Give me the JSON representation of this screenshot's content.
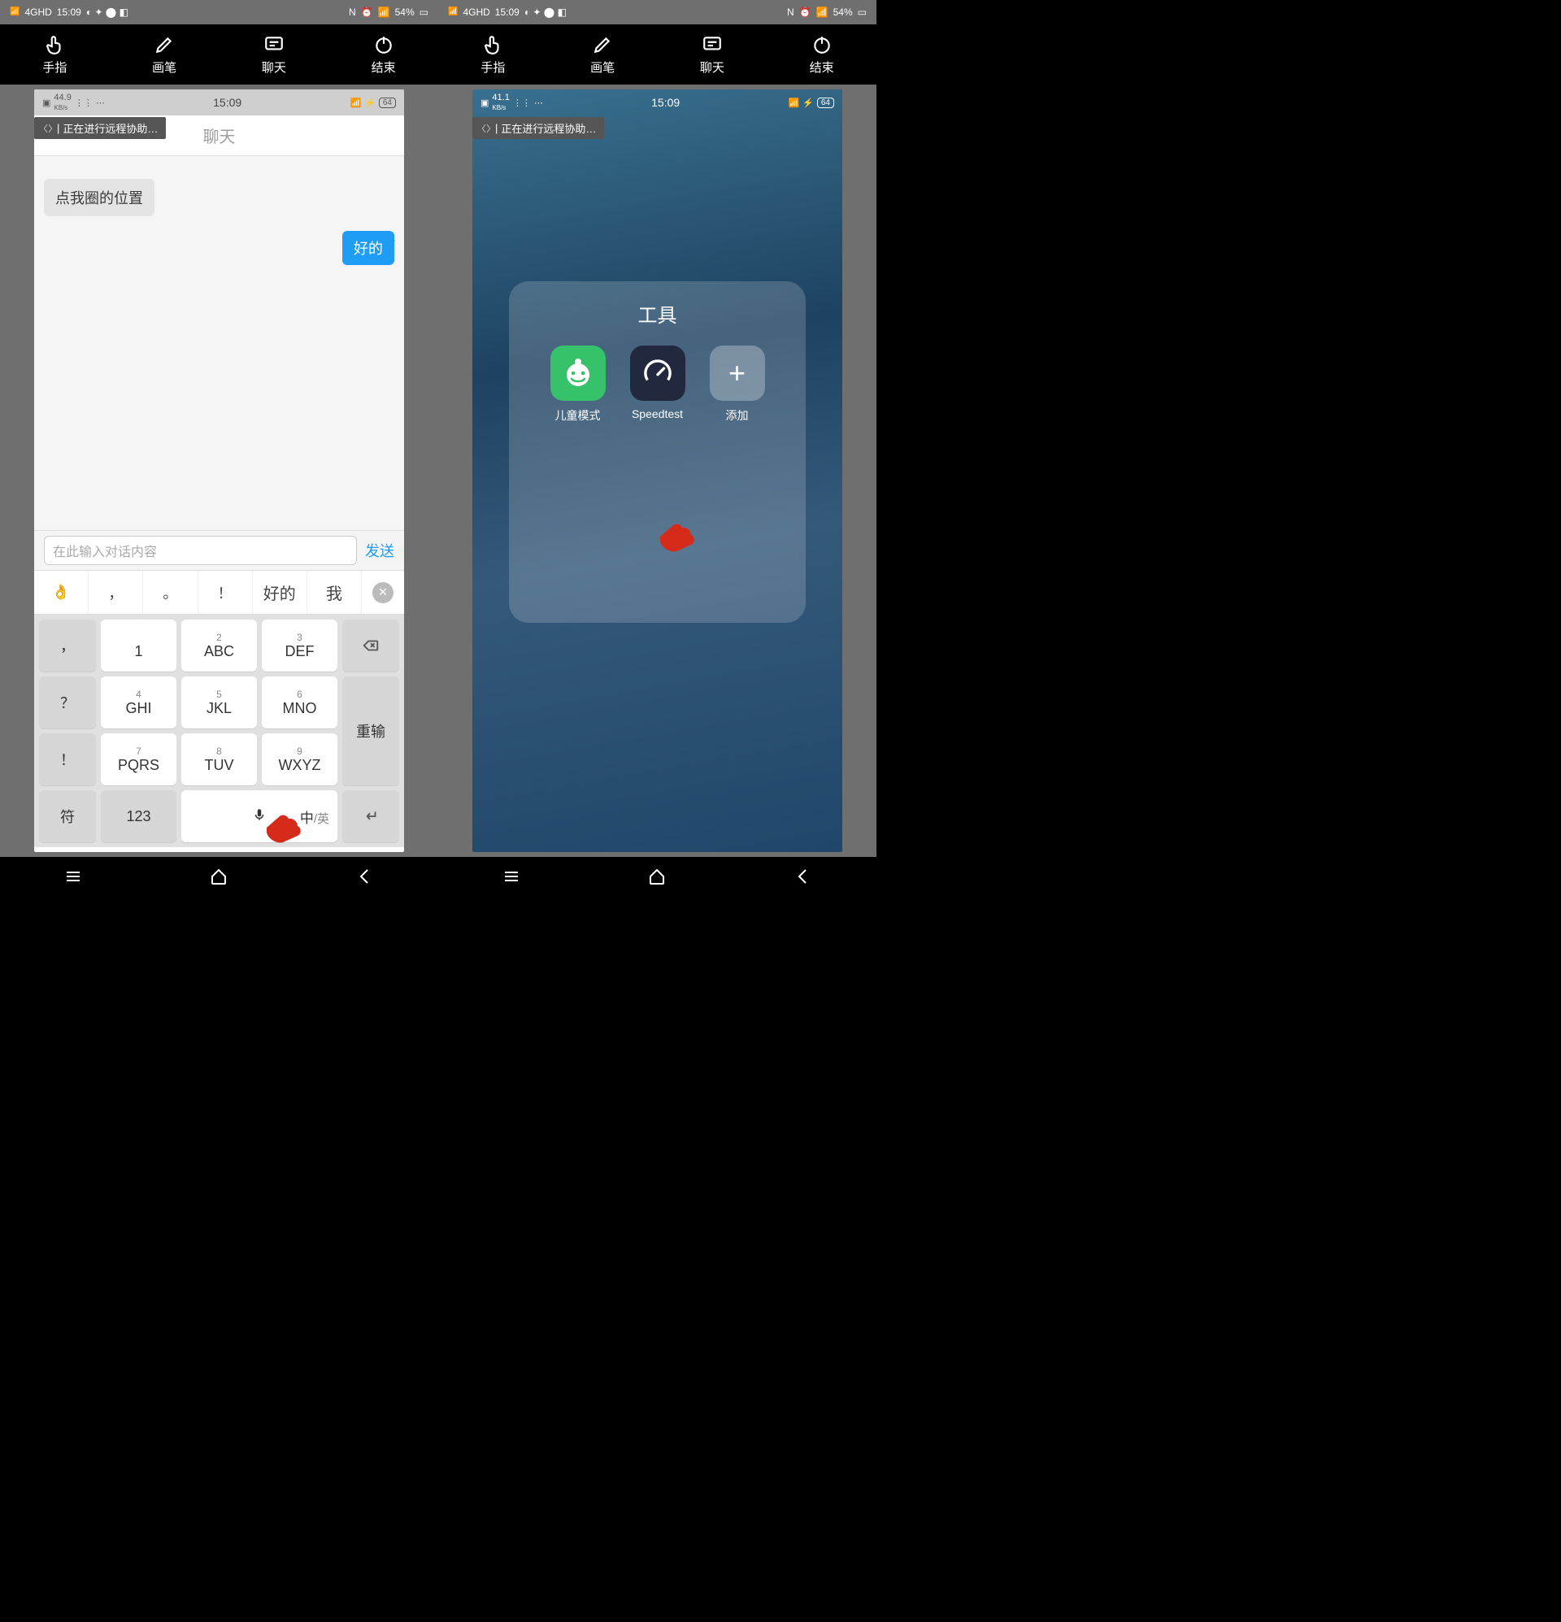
{
  "outerStatus": {
    "netLabel": "4GHD",
    "time": "15:09",
    "battery": "54%"
  },
  "toolbar": {
    "finger": "手指",
    "brush": "画笔",
    "chat": "聊天",
    "end": "结束"
  },
  "remoteBanner": "正在进行远程协助…",
  "leftPhone": {
    "status": {
      "speed": "44.9",
      "speedUnit": "KB/s",
      "time": "15:09",
      "batt": "64"
    },
    "chatTitle": "聊天",
    "msgIn": "点我圈的位置",
    "msgOut": "好的",
    "inputPlaceholder": "在此输入对话内容",
    "sendLabel": "发送",
    "suggestions": [
      "👌",
      "，",
      "。",
      "！",
      "好的",
      "我"
    ],
    "keys": {
      "r1": [
        {
          "sym": "，"
        },
        {
          "n": "1"
        },
        {
          "n": "2",
          "l": "ABC"
        },
        {
          "n": "3",
          "l": "DEF"
        },
        {
          "sym": "bksp"
        }
      ],
      "r2": [
        {
          "sym": "？"
        },
        {
          "n": "4",
          "l": "GHI"
        },
        {
          "n": "5",
          "l": "JKL"
        },
        {
          "n": "6",
          "l": "MNO"
        },
        {
          "sym": "重输"
        }
      ],
      "r3": [
        {
          "sym": "！"
        },
        {
          "n": "7",
          "l": "PQRS"
        },
        {
          "n": "8",
          "l": "TUV"
        },
        {
          "n": "9",
          "l": "WXYZ"
        }
      ],
      "r4": {
        "fn": "符",
        "num": "123",
        "langZh": "中",
        "langEn": "英"
      }
    }
  },
  "rightPhone": {
    "status": {
      "speed": "41.1",
      "speedUnit": "KB/s",
      "time": "15:09",
      "batt": "64"
    },
    "folderTitle": "工具",
    "apps": [
      {
        "id": "kids",
        "label": "儿童模式"
      },
      {
        "id": "speed",
        "label": "Speedtest"
      },
      {
        "id": "add",
        "label": "添加"
      }
    ]
  }
}
